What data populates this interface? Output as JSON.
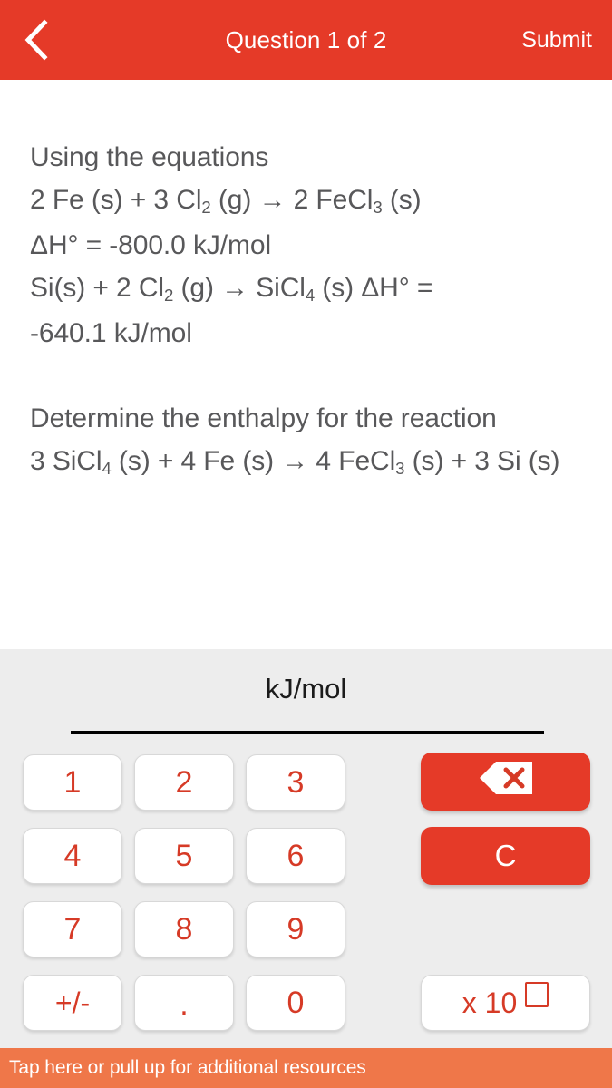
{
  "header": {
    "back_icon": "chevron-left-icon",
    "title": "Question 1 of 2",
    "submit_label": "Submit",
    "background_color": "#e53a28",
    "text_color": "#ffffff"
  },
  "question": {
    "intro": "Using the equations",
    "equation_1_line1_pre": "2 Fe (s) + 3 Cl",
    "equation_1_line1_sub1": "2",
    "equation_1_line1_mid": " (g) → 2 FeCl",
    "equation_1_line1_sub2": "3",
    "equation_1_line1_post": " (s)",
    "equation_1_line2": "ΔH° = -800.0 kJ/mol",
    "equation_2_pre": "Si(s) + 2 Cl",
    "equation_2_sub1": "2",
    "equation_2_mid": " (g) → SiCl",
    "equation_2_sub2": "4",
    "equation_2_post": " (s) ΔH° =",
    "equation_2_value": "-640.1 kJ/mol",
    "prompt": "Determine the enthalpy for the reaction",
    "target_pre": "3 SiCl",
    "target_sub1": "4",
    "target_mid": " (s) + 4 Fe (s) → 4 FeCl",
    "target_sub2": "3",
    "target_post": " (s) + 3 Si (s)",
    "text_color": "#58585a"
  },
  "answer": {
    "unit": "kJ/mol",
    "value": "",
    "placeholder": ""
  },
  "keypad": {
    "background_color": "#ededed",
    "digit_color": "#d63a26",
    "keys": [
      {
        "name": "key-1",
        "label": "1"
      },
      {
        "name": "key-2",
        "label": "2"
      },
      {
        "name": "key-3",
        "label": "3"
      },
      {
        "name": "key-4",
        "label": "4"
      },
      {
        "name": "key-5",
        "label": "5"
      },
      {
        "name": "key-6",
        "label": "6"
      },
      {
        "name": "key-7",
        "label": "7"
      },
      {
        "name": "key-8",
        "label": "8"
      },
      {
        "name": "key-9",
        "label": "9"
      },
      {
        "name": "key-plus-minus",
        "label": "+/-"
      },
      {
        "name": "key-decimal",
        "label": "."
      },
      {
        "name": "key-0",
        "label": "0"
      }
    ],
    "backspace_icon": "backspace-icon",
    "clear_label": "C",
    "exponent_label": "x 10",
    "action_color": "#e53a28"
  },
  "bottom_bar": {
    "text": "Tap here or pull up for additional resources",
    "background_color": "#ef7749",
    "text_color": "#ffffff"
  }
}
